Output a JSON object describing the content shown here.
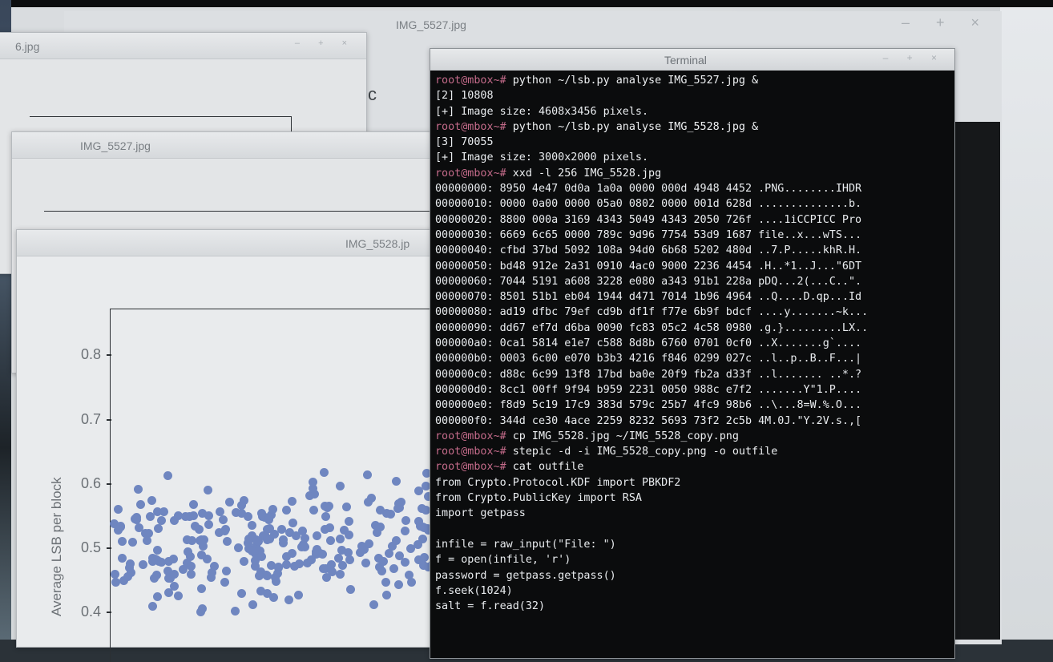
{
  "windows": {
    "main": {
      "title": "IMG_5527.jpg",
      "controls": "– + ×"
    },
    "win_a": {
      "title": "6.jpg",
      "controls": "– + ×"
    },
    "win_b": {
      "title": "IMG_5527.jpg"
    },
    "win_c": {
      "title": "IMG_5528.jp"
    },
    "terminal": {
      "title": "Terminal",
      "controls": "– + ×"
    }
  },
  "plot": {
    "ylabel": "Average LSB per block",
    "yticks": [
      "0.8",
      "0.7",
      "0.6",
      "0.5",
      "0.4"
    ],
    "fragment_char": "c"
  },
  "terminal_lines": [
    {
      "p": "root@mbox~# ",
      "t": "python ~/lsb.py analyse IMG_5527.jpg &"
    },
    {
      "p": "",
      "t": "[2] 10808"
    },
    {
      "p": "",
      "t": "[+] Image size: 4608x3456 pixels."
    },
    {
      "p": "root@mbox~# ",
      "t": "python ~/lsb.py analyse IMG_5528.jpg &"
    },
    {
      "p": "",
      "t": "[3] 70055"
    },
    {
      "p": "",
      "t": "[+] Image size: 3000x2000 pixels."
    },
    {
      "p": "root@mbox~# ",
      "t": "xxd -l 256 IMG_5528.jpg"
    },
    {
      "p": "",
      "t": "00000000: 8950 4e47 0d0a 1a0a 0000 000d 4948 4452 .PNG........IHDR"
    },
    {
      "p": "",
      "t": "00000010: 0000 0a00 0000 05a0 0802 0000 001d 628d ..............b."
    },
    {
      "p": "",
      "t": "00000020: 8800 000a 3169 4343 5049 4343 2050 726f ....1iCCPICC Pro"
    },
    {
      "p": "",
      "t": "00000030: 6669 6c65 0000 789c 9d96 7754 53d9 1687 file..x...wTS..."
    },
    {
      "p": "",
      "t": "00000040: cfbd 37bd 5092 108a 94d0 6b68 5202 480d ..7.P.....khR.H."
    },
    {
      "p": "",
      "t": "00000050: bd48 912e 2a31 0910 4ac0 9000 2236 4454 .H..*1..J...\"6DT"
    },
    {
      "p": "",
      "t": "00000060: 7044 5191 a608 3228 e080 a343 91b1 228a pDQ...2(...C..\"."
    },
    {
      "p": "",
      "t": "00000070: 8501 51b1 eb04 1944 d471 7014 1b96 4964 ..Q....D.qp...Id"
    },
    {
      "p": "",
      "t": "00000080: ad19 dfbc 79ef cd9b df1f f77e 6b9f bdcf ....y.......~k..."
    },
    {
      "p": "",
      "t": "00000090: dd67 ef7d d6ba 0090 fc83 05c2 4c58 0980 .g.}.........LX.."
    },
    {
      "p": "",
      "t": "000000a0: 0ca1 5814 e1e7 c588 8d8b 6760 0701 0cf0 ..X.......g`...."
    },
    {
      "p": "",
      "t": "000000b0: 0003 6c00 e070 b3b3 4216 f846 0299 027c ..l..p..B..F...|"
    },
    {
      "p": "",
      "t": "000000c0: d88c 6c99 13f8 17bd ba0e 20f9 fb2a d33f ..l....... ..*.?"
    },
    {
      "p": "",
      "t": "000000d0: 8cc1 00ff 9f94 b959 2231 0050 988c e7f2 .......Y\"1.P...."
    },
    {
      "p": "",
      "t": "000000e0: f8d9 5c19 17c9 383d 579c 25b7 4fc9 98b6 ..\\...8=W.%.O..."
    },
    {
      "p": "",
      "t": "000000f0: 344d ce30 4ace 2259 8232 5693 73f2 2c5b 4M.0J.\"Y.2V.s.,["
    },
    {
      "p": "root@mbox~# ",
      "t": "cp IMG_5528.jpg ~/IMG_5528_copy.png"
    },
    {
      "p": "root@mbox~# ",
      "t": "stepic -d -i IMG_5528_copy.png -o outfile"
    },
    {
      "p": "root@mbox~# ",
      "t": "cat outfile"
    },
    {
      "p": "",
      "t": "from Crypto.Protocol.KDF import PBKDF2"
    },
    {
      "p": "",
      "t": "from Crypto.PublicKey import RSA"
    },
    {
      "p": "",
      "t": "import getpass"
    },
    {
      "p": "",
      "t": ""
    },
    {
      "p": "",
      "t": "infile = raw_input(\"File: \")"
    },
    {
      "p": "",
      "t": "f = open(infile, 'r')"
    },
    {
      "p": "",
      "t": "password = getpass.getpass()"
    },
    {
      "p": "",
      "t": "f.seek(1024)"
    },
    {
      "p": "",
      "t": "salt = f.read(32)"
    }
  ],
  "colors": {
    "prompt": "#c46b8a",
    "dot": "#6f86c0",
    "terminal_bg": "#0b0c0d"
  }
}
